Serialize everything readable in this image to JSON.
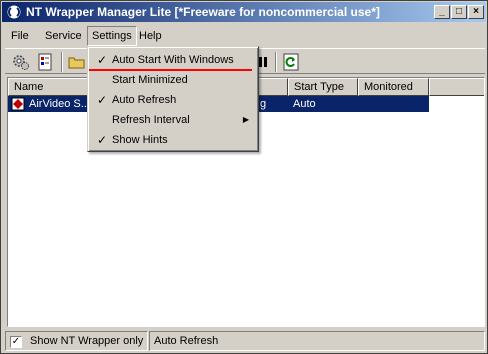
{
  "window": {
    "title": "NT Wrapper Manager Lite [*Freeware for noncommercial use*]",
    "minimize": "_",
    "maximize": "□",
    "close": "×"
  },
  "menubar": {
    "file": "File",
    "service": "Service",
    "settings": "Settings",
    "help": "Help"
  },
  "settings_menu": {
    "items": [
      {
        "label": "Auto Start With Windows",
        "checked": true,
        "check": "✓"
      },
      {
        "label": "Start Minimized",
        "checked": false,
        "check": ""
      },
      {
        "label": "Auto Refresh",
        "checked": true,
        "check": "✓"
      },
      {
        "label": "Refresh Interval",
        "checked": false,
        "check": "",
        "submenu": "▶"
      },
      {
        "label": "Show Hints",
        "checked": true,
        "check": "✓"
      }
    ]
  },
  "list": {
    "columns": [
      "Name",
      "",
      "",
      "Start Type",
      "Monitored"
    ],
    "rows": [
      {
        "name": "AirVideo S...",
        "status": "g",
        "start_type": "Auto",
        "monitored": ""
      }
    ]
  },
  "statusbar": {
    "show_nt_wrapper_only": "Show NT Wrapper only",
    "show_nt_wrapper_checked": "✓",
    "auto_refresh": "Auto Refresh"
  },
  "colors": {
    "selection": "#0a246a",
    "titlebar_start": "#0a246a",
    "titlebar_end": "#a6caf0",
    "face": "#d4d0c8",
    "annotation": "#ff0000"
  }
}
